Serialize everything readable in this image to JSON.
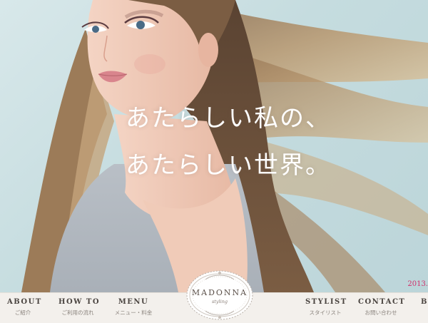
{
  "hero": {
    "catch_line_1": "あたらしい私の、",
    "catch_line_2": "あたらしい世界。",
    "date": "2013."
  },
  "logo": {
    "name": "MADONNA",
    "sub": "styling"
  },
  "nav": {
    "items": [
      {
        "en": "ABOUT",
        "ja": "ご紹介"
      },
      {
        "en": "HOW TO",
        "ja": "ご利用の流れ"
      },
      {
        "en": "MENU",
        "ja": "メニュー・料金"
      },
      {
        "en": "STYLIST",
        "ja": "スタイリスト"
      },
      {
        "en": "CONTACT",
        "ja": "お問い合わせ"
      },
      {
        "en": "B",
        "ja": ""
      }
    ]
  },
  "colors": {
    "background": "#c9dfe1",
    "nav_background": "#f3f0ec",
    "accent_date": "#d0306a"
  }
}
